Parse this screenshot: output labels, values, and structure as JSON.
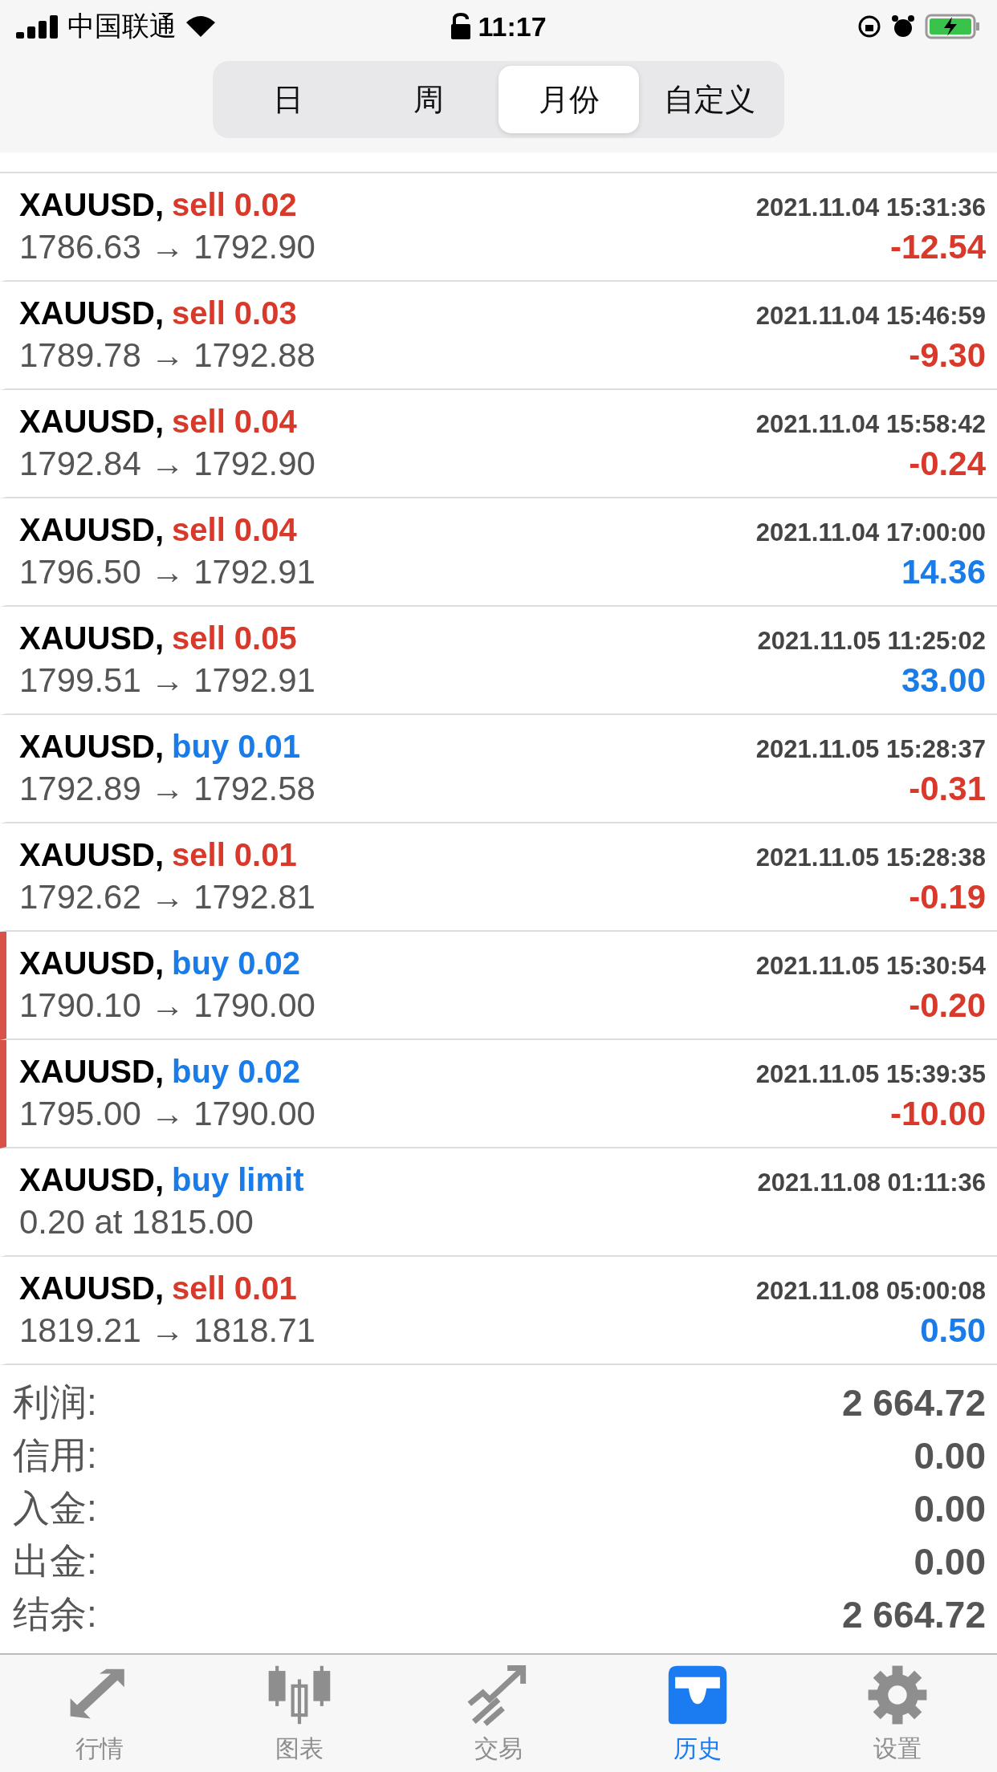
{
  "status_bar": {
    "carrier": "中国联通",
    "time": "11:17"
  },
  "period_tabs": [
    {
      "label": "日",
      "selected": false
    },
    {
      "label": "周",
      "selected": false
    },
    {
      "label": "月份",
      "selected": true
    },
    {
      "label": "自定义",
      "selected": false
    }
  ],
  "deals": [
    {
      "symbol": "XAUUSD,",
      "kind": "sell",
      "order": "sell 0.02",
      "time": "2021.11.04 15:31:36",
      "prices": "1786.63 → 1792.90",
      "profit": {
        "value": "-12.54",
        "kind": "loss"
      },
      "marked": false
    },
    {
      "symbol": "XAUUSD,",
      "kind": "sell",
      "order": "sell 0.03",
      "time": "2021.11.04 15:46:59",
      "prices": "1789.78 → 1792.88",
      "profit": {
        "value": "-9.30",
        "kind": "loss"
      },
      "marked": false
    },
    {
      "symbol": "XAUUSD,",
      "kind": "sell",
      "order": "sell 0.04",
      "time": "2021.11.04 15:58:42",
      "prices": "1792.84 → 1792.90",
      "profit": {
        "value": "-0.24",
        "kind": "loss"
      },
      "marked": false
    },
    {
      "symbol": "XAUUSD,",
      "kind": "sell",
      "order": "sell 0.04",
      "time": "2021.11.04 17:00:00",
      "prices": "1796.50 → 1792.91",
      "profit": {
        "value": "14.36",
        "kind": "gain"
      },
      "marked": false
    },
    {
      "symbol": "XAUUSD,",
      "kind": "sell",
      "order": "sell 0.05",
      "time": "2021.11.05 11:25:02",
      "prices": "1799.51 → 1792.91",
      "profit": {
        "value": "33.00",
        "kind": "gain"
      },
      "marked": false
    },
    {
      "symbol": "XAUUSD,",
      "kind": "buy",
      "order": "buy 0.01",
      "time": "2021.11.05 15:28:37",
      "prices": "1792.89 → 1792.58",
      "profit": {
        "value": "-0.31",
        "kind": "loss"
      },
      "marked": false
    },
    {
      "symbol": "XAUUSD,",
      "kind": "sell",
      "order": "sell 0.01",
      "time": "2021.11.05 15:28:38",
      "prices": "1792.62 → 1792.81",
      "profit": {
        "value": "-0.19",
        "kind": "loss"
      },
      "marked": false
    },
    {
      "symbol": "XAUUSD,",
      "kind": "buy",
      "order": "buy 0.02",
      "time": "2021.11.05 15:30:54",
      "prices": "1790.10 → 1790.00",
      "profit": {
        "value": "-0.20",
        "kind": "loss"
      },
      "marked": true
    },
    {
      "symbol": "XAUUSD,",
      "kind": "buy",
      "order": "buy 0.02",
      "time": "2021.11.05 15:39:35",
      "prices": "1795.00 → 1790.00",
      "profit": {
        "value": "-10.00",
        "kind": "loss"
      },
      "marked": true
    },
    {
      "symbol": "XAUUSD,",
      "kind": "buy",
      "order": "buy limit",
      "time": "2021.11.08 01:11:36",
      "prices": "0.20 at 1815.00",
      "marked": false
    },
    {
      "symbol": "XAUUSD,",
      "kind": "sell",
      "order": "sell 0.01",
      "time": "2021.11.08 05:00:08",
      "prices": "1819.21 → 1818.71",
      "profit": {
        "value": "0.50",
        "kind": "gain"
      },
      "marked": false
    }
  ],
  "summary": [
    {
      "label": "利润:",
      "value": "2 664.72"
    },
    {
      "label": "信用:",
      "value": "0.00"
    },
    {
      "label": "入金:",
      "value": "0.00"
    },
    {
      "label": "出金:",
      "value": "0.00"
    },
    {
      "label": "结余:",
      "value": "2 664.72"
    }
  ],
  "tab_bar": [
    {
      "kind": "quotes",
      "label": "行情",
      "selected": false
    },
    {
      "kind": "chart",
      "label": "图表",
      "selected": false
    },
    {
      "kind": "trade",
      "label": "交易",
      "selected": false
    },
    {
      "kind": "history",
      "label": "历史",
      "selected": true
    },
    {
      "kind": "settings",
      "label": "设置",
      "selected": false
    }
  ]
}
